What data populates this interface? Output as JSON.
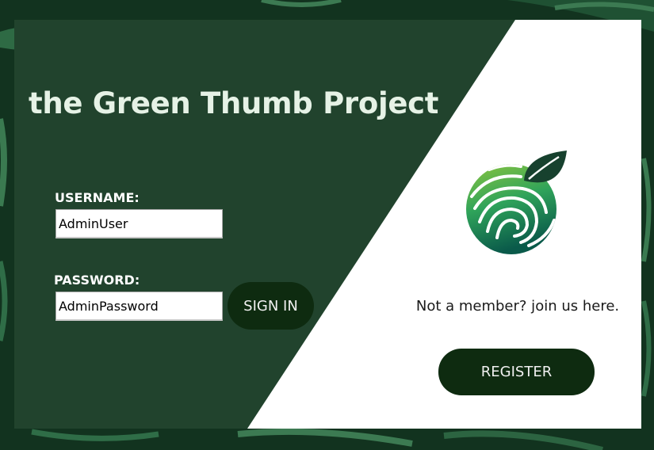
{
  "app": {
    "title": "the Green Thumb Project"
  },
  "login": {
    "username_label": "USERNAME:",
    "username_value": "AdminUser",
    "password_label": "PASSWORD:",
    "password_value": "AdminPassword",
    "signin_label": "SIGN IN"
  },
  "register_panel": {
    "prompt": "Not a member? join us here.",
    "register_label": "REGISTER"
  },
  "icons": {
    "logo": "fingerprint-leaf-logo-icon"
  },
  "colors": {
    "panel_dark": "#21432d",
    "button": "#0e2b10",
    "title_text": "#e6f2e6",
    "panel_light": "#ffffff"
  }
}
